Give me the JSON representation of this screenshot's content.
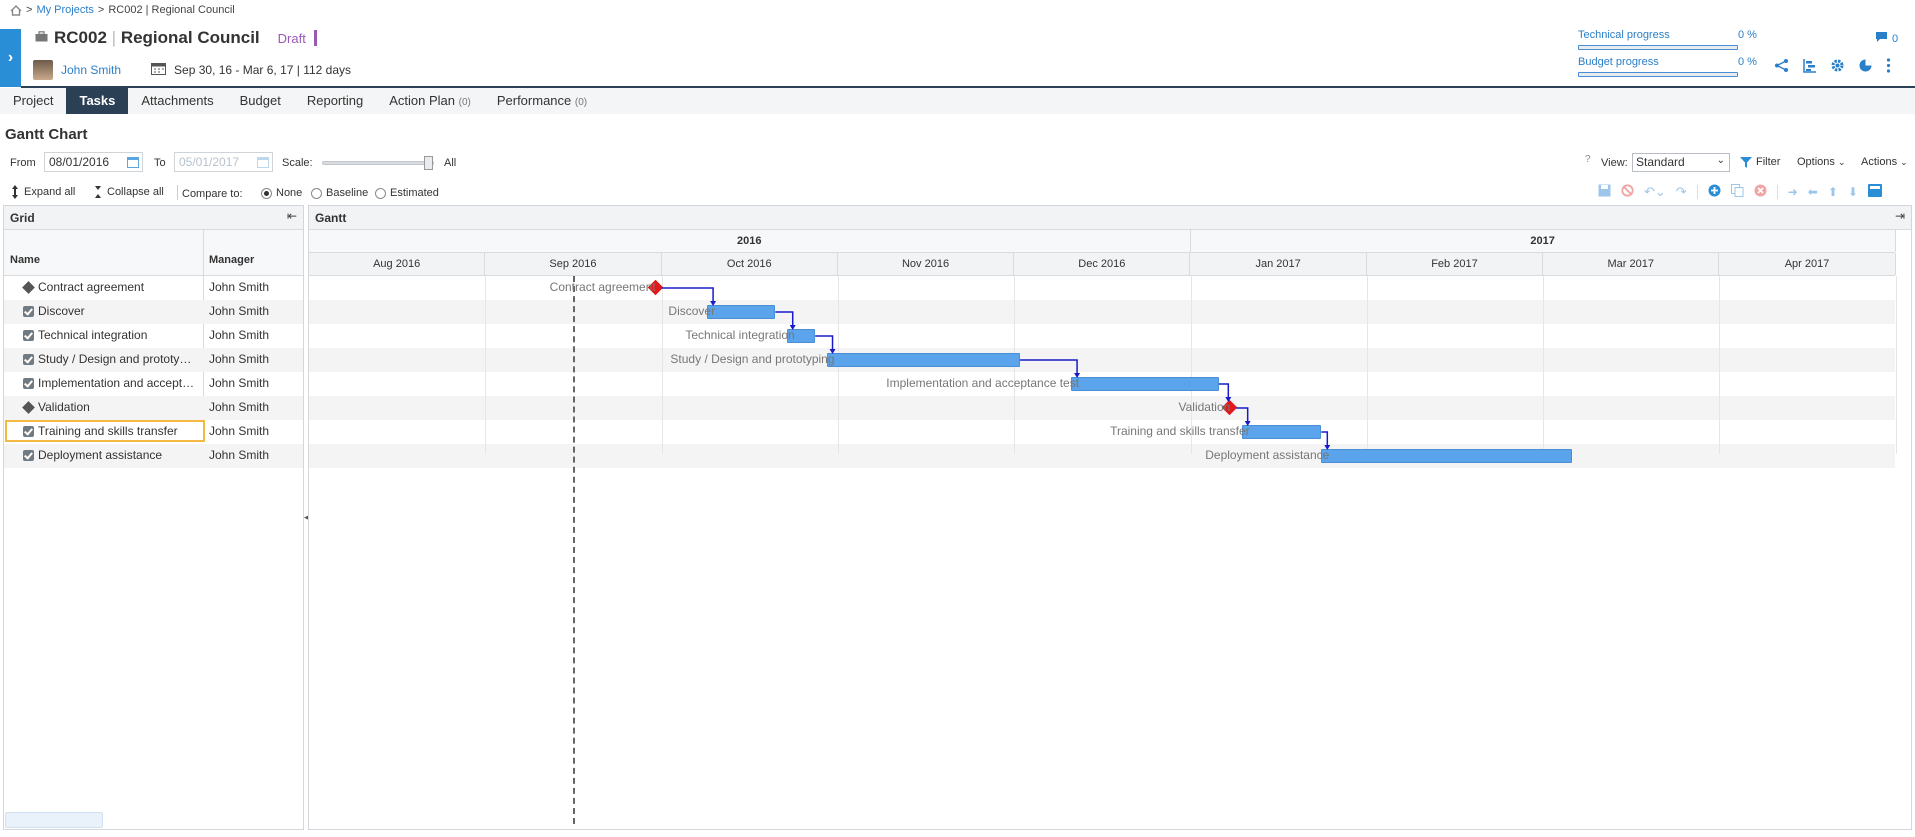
{
  "breadcrumb": {
    "home_icon": "home-icon",
    "sep1": ">",
    "my_projects": "My Projects",
    "sep2": ">",
    "current": "RC002 | Regional Council"
  },
  "project": {
    "code": "RC002",
    "sep": "|",
    "name": "Regional Council",
    "status": "Draft",
    "status_color": "#9b59b6",
    "manager": "John Smith",
    "dates": "Sep 30, 16 - Mar 6, 17 | 112 days"
  },
  "progress": [
    {
      "label": "Technical progress",
      "value": "0 %",
      "fraction": 0
    },
    {
      "label": "Budget progress",
      "value": "0 %",
      "fraction": 0
    }
  ],
  "header_icons": {
    "comments_count": "0"
  },
  "tabs": [
    {
      "label": "Project",
      "count": ""
    },
    {
      "label": "Tasks",
      "count": "",
      "active": true
    },
    {
      "label": "Attachments",
      "count": ""
    },
    {
      "label": "Budget",
      "count": ""
    },
    {
      "label": "Reporting",
      "count": ""
    },
    {
      "label": "Action Plan",
      "count": "(0)"
    },
    {
      "label": "Performance",
      "count": "(0)"
    }
  ],
  "gantt": {
    "heading": "Gantt Chart",
    "from_label": "From",
    "from_value": "08/01/2016",
    "to_label": "To",
    "to_value": "05/01/2017",
    "scale_label": "Scale:",
    "scale_value": "All",
    "view_help": "?",
    "view_label": "View:",
    "view_value": "Standard",
    "filter": "Filter",
    "options": "Options",
    "actions": "Actions",
    "expand_all": "Expand all",
    "collapse_all": "Collapse all",
    "compare_label": "Compare to:",
    "compare_options": [
      "None",
      "Baseline",
      "Estimated"
    ],
    "compare_selected": "None",
    "grid_title": "Grid",
    "gantt_title": "Gantt",
    "col_name": "Name",
    "col_manager": "Manager",
    "years": [
      "2016",
      "2017"
    ],
    "months": [
      "Aug 2016",
      "Sep 2016",
      "Oct 2016",
      "Nov 2016",
      "Dec 2016",
      "Jan 2017",
      "Feb 2017",
      "Mar 2017",
      "Apr 2017"
    ],
    "tasks": [
      {
        "name": "Contract agreement",
        "manager": "John Smith",
        "type": "milestone",
        "start": "2016-09-30"
      },
      {
        "name": "Discover",
        "manager": "John Smith",
        "type": "task",
        "start": "2016-10-09",
        "end": "2016-10-21"
      },
      {
        "name": "Technical integration",
        "manager": "John Smith",
        "type": "task",
        "start": "2016-10-23",
        "end": "2016-10-28"
      },
      {
        "name": "Study / Design and prototyp…",
        "label": "Study / Design and prototyping",
        "manager": "John Smith",
        "type": "task",
        "start": "2016-10-30",
        "end": "2016-12-02"
      },
      {
        "name": "Implementation and accept…",
        "label": "Implementation and acceptance test",
        "manager": "John Smith",
        "type": "task",
        "start": "2016-12-11",
        "end": "2017-01-06"
      },
      {
        "name": "Validation",
        "manager": "John Smith",
        "type": "milestone",
        "start": "2017-01-08"
      },
      {
        "name": "Training and skills transfer",
        "manager": "John Smith",
        "type": "task",
        "start": "2017-01-10",
        "end": "2017-01-24"
      },
      {
        "name": "Deployment assistance",
        "manager": "John Smith",
        "type": "task",
        "start": "2017-01-24",
        "end": "2017-03-06"
      }
    ],
    "selected_row": 6,
    "today": "2016-09-16",
    "colors": {
      "bar": "#5ba3ea",
      "milestone": "#e01a1a",
      "link": "#1a1acc"
    }
  }
}
